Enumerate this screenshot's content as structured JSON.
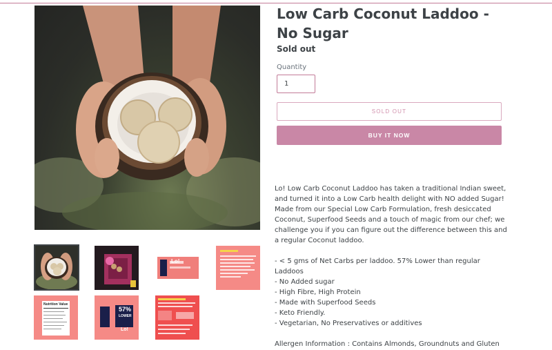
{
  "product": {
    "title": "Low Carb Coconut Laddoo - No Sugar",
    "stock_status": "Sold out",
    "quantity_label": "Quantity",
    "quantity_value": "1",
    "sold_out_button": "SOLD OUT",
    "buy_button": "BUY IT NOW"
  },
  "description": {
    "intro": "Lo! Low Carb Coconut Laddoo has taken a traditional Indian sweet, and turned it into a Low Carb health delight with NO added Sugar! Made from our Special Low Carb Formulation, fresh desiccated Coconut, Superfood Seeds and a touch of magic from our chef; we challenge you if you can figure out the difference between this and a regular Coconut laddoo.",
    "bullets": [
      "- < 5 gms of Net Carbs per laddoo. 57% Lower than regular Laddoos",
      "- No Added sugar",
      "- High Fibre, High Protein",
      "- Made with Superfood Seeds",
      "- Keto Friendly.",
      "- Vegetarian, No Preservatives or additives"
    ],
    "allergen": "Allergen Information : Contains Almonds, Groundnuts and Gluten"
  },
  "thumbnails": {
    "pack_logo": "Lo!",
    "nutrition_title": "Nutrition Value",
    "lower_percent": "57%",
    "lower_word": "LOWER",
    "back_logo": "Lo!"
  },
  "colors": {
    "accent": "#c987a6",
    "accent_border": "#c27a97",
    "salmon": "#f47c7c",
    "text": "#3d4246"
  }
}
